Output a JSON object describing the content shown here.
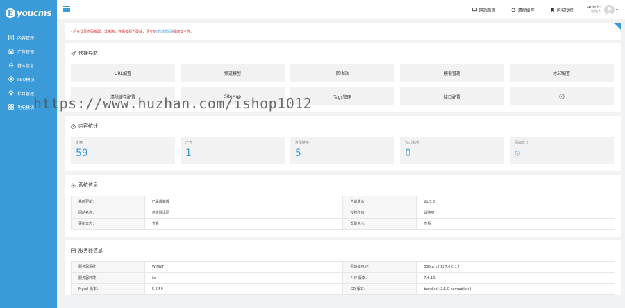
{
  "brand": {
    "mark": "E",
    "name": "youcms"
  },
  "sidebar": {
    "items": [
      {
        "label": "内容管理",
        "icon": "document-icon"
      },
      {
        "label": "广告管理",
        "icon": "ad-icon"
      },
      {
        "label": "基本信息",
        "icon": "gear-icon"
      },
      {
        "label": "SEO模块",
        "icon": "seo-icon"
      },
      {
        "label": "栏目管理",
        "icon": "layers-icon"
      },
      {
        "label": "功能模块",
        "icon": "grid-icon"
      }
    ]
  },
  "topbar": {
    "site_home": "网站首页",
    "clear_cache": "清除缓存",
    "buy_license": "购买授权",
    "user_name": "admin",
    "user_role": "创始人"
  },
  "notice": {
    "text_before": "· 后台登录密码提醒：非常简，容易被暴力破解，请立刻",
    "link": "[修改密码]",
    "text_after": "提高安全性。"
  },
  "quick_nav": {
    "title": "快捷导航",
    "items": [
      "URL配置",
      "频道模型",
      "回收站",
      "模板管理",
      "水印配置",
      "清除缓存配置",
      "SiteMap",
      "Tags管理",
      "接口配置"
    ]
  },
  "stats": {
    "title": "内容统计",
    "items": [
      {
        "label": "文章",
        "value": "59"
      },
      {
        "label": "广告",
        "value": "1"
      },
      {
        "label": "友情链接",
        "value": "5"
      },
      {
        "label": "Tags标签",
        "value": "0"
      }
    ],
    "add_label": "添加统计"
  },
  "system_info": {
    "title": "系统信息",
    "rows": [
      [
        "系统更新：",
        "已是最新版",
        "当前版本：",
        "v1.5.8"
      ],
      [
        "网站名称：",
        "佳文翻译网",
        "授权所有：",
        "请购买"
      ],
      [
        "更新日志：",
        "查看",
        "帮助中心：",
        "查看"
      ]
    ]
  },
  "server_info": {
    "title": "服务器信息",
    "rows": [
      [
        "服务器系统：",
        "WINNT",
        "网站域名/IP：",
        "536.zm [ 127.0.0.1 ]"
      ],
      [
        "服务器环境：",
        "iis",
        "PHP 版本：",
        "7.4.16"
      ],
      [
        "Mysql 版本：",
        "5.6.50",
        "GD 版本：",
        "bundled (2.1.0 compatible)"
      ]
    ]
  },
  "watermark": "https://www.huzhan.com/ishop1012",
  "colors": {
    "accent": "#3b9ad8",
    "notice": "#dd3333"
  }
}
